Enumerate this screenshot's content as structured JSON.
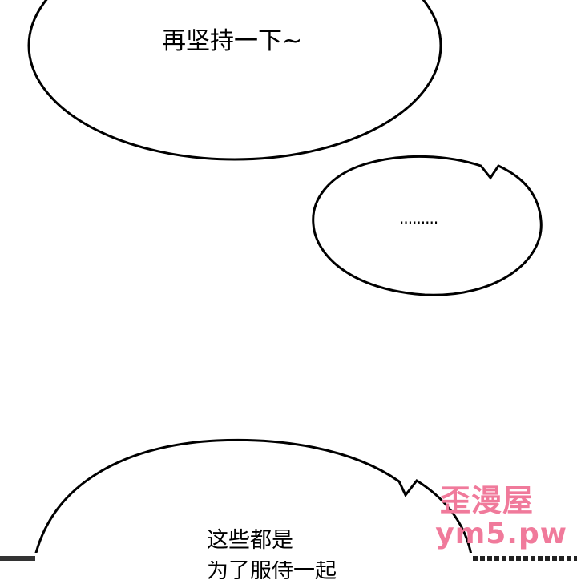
{
  "panel": {
    "bubble_top_text": "再坚持一下~",
    "bubble_mid_text": ".........",
    "bubble_bottom_line1": "这些都是",
    "bubble_bottom_line2": "为了服侍一起"
  },
  "watermark": {
    "line1": "歪漫屋",
    "line2": "ym5.pw",
    "color": "#f07a9b"
  }
}
